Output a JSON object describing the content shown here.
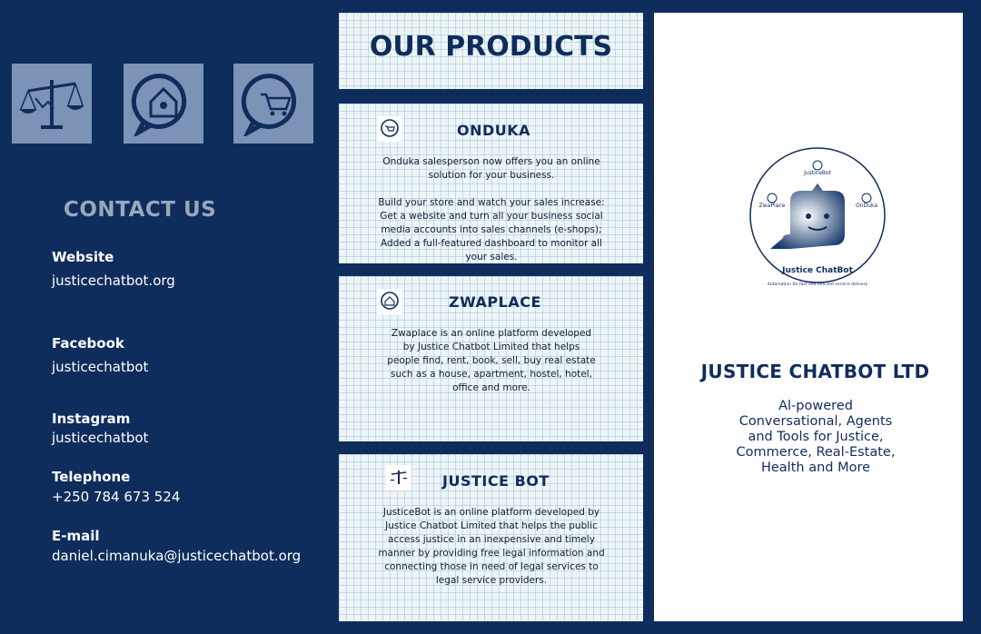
{
  "contact": {
    "title": "CONTACT US",
    "items": [
      {
        "label": "Website",
        "value": "justicechatbot.org"
      },
      {
        "label": "Facebook",
        "value": "justicechatbot"
      },
      {
        "label": "Instagram",
        "value": "justicechatbot"
      },
      {
        "label": "Telephone",
        "value": "+250 784 673 524"
      },
      {
        "label": "E-mail",
        "value": "daniel.cimanuka@justicechatbot.org"
      }
    ]
  },
  "icons": [
    "scales-icon",
    "house-pin-icon",
    "cart-pin-icon"
  ],
  "products": {
    "title": "OUR PRODUCTS",
    "items": [
      {
        "name": "ONDUKA",
        "icon": "cart-pin-icon",
        "description": "Onduka salesperson now offers you an online\nsolution for your business.\n\nBuild your store and watch your sales increase:\nGet a website and turn all your business social\nmedia accounts into sales channels (e-shops);\nAdded a full-featured dashboard to monitor all\nyour sales."
      },
      {
        "name": "ZWAPLACE",
        "icon": "house-pin-icon",
        "description": "Zwaplace is an online platform developed\nby Justice Chatbot Limited that helps\npeople find, rent, book, sell, buy real estate\nsuch as a house, apartment, hostel, hotel,\noffice and more."
      },
      {
        "name": "JUSTICE BOT",
        "icon": "scales-icon",
        "description": "JusticeBot is an online platform developed by\nJustice Chatbot Limited that helps the public\naccess justice in an inexpensive and timely\nmanner by providing free legal information and\nconnecting those in need of legal services to\nlegal service providers."
      }
    ]
  },
  "company": {
    "name": "JUSTICE CHATBOT LTD",
    "tagline": "Al-powered\nConversational, Agents\nand Tools for Justice,\nCommerce, Real-Estate,\nHealth and More",
    "logo": {
      "title": "Justice ChatBot",
      "subtitle": "Automation for fast and efficient service delivery",
      "labels": [
        "JusticeBot",
        "ZwaPlace",
        "OnDuka"
      ]
    }
  },
  "colors": {
    "background": "#0f2d5c",
    "icon_box": "#7c93b8",
    "panel": "#eef5f7",
    "text_dark": "#0f2d5c"
  }
}
